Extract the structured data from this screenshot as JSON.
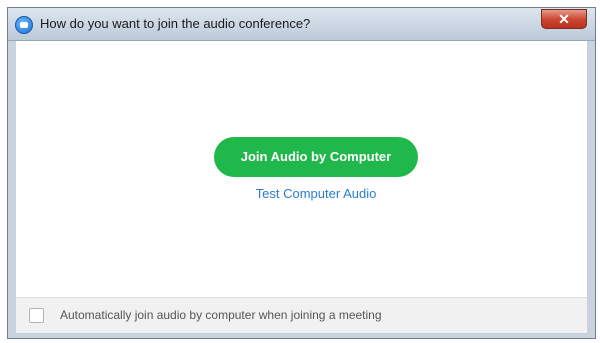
{
  "window": {
    "title": "How do you want to join the audio conference?",
    "app_icon": "zoom-camera-icon",
    "close_label": "✕"
  },
  "main": {
    "join_button_label": "Join Audio by Computer",
    "join_button_color": "#21b84b",
    "test_link_label": "Test Computer Audio",
    "link_color": "#2b7cd0"
  },
  "footer": {
    "auto_join_label": "Automatically join audio by computer when joining a meeting",
    "auto_join_checked": false
  }
}
